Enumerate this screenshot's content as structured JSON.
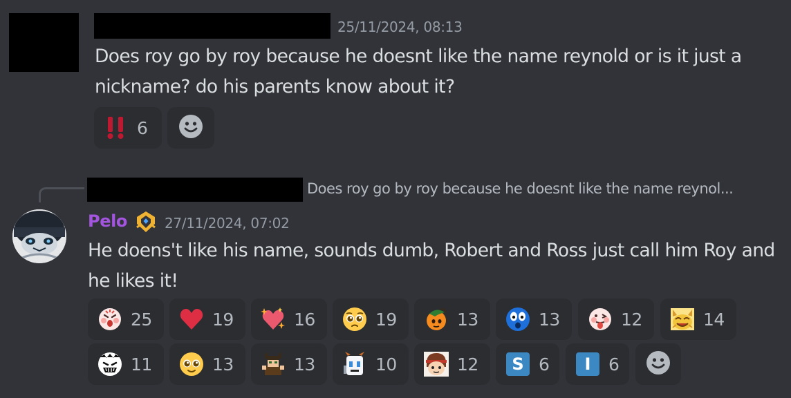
{
  "message1": {
    "timestamp": "25/11/2024, 08:13",
    "text": "Does roy go by roy because he doesnt like the name reynold or is it just a nickname? do his parents know about it?",
    "reactions": [
      {
        "emoji": "double-exclamation",
        "count": "6"
      }
    ]
  },
  "message2": {
    "reply_preview": "Does roy go by roy because he doesnt like the name reynol...",
    "author": "Pelo",
    "author_color": "#a455df",
    "timestamp": "27/11/2024, 07:02",
    "text": "He doens't like his name, sounds dumb, Robert and Ross just call him Roy and he likes it!",
    "reactions": [
      {
        "emoji": "shocked-face",
        "count": "25"
      },
      {
        "emoji": "red-heart",
        "count": "19"
      },
      {
        "emoji": "sparkling-heart",
        "count": "16"
      },
      {
        "emoji": "pleading-face",
        "count": "19"
      },
      {
        "emoji": "orange-character",
        "count": "13"
      },
      {
        "emoji": "blue-shocked-face",
        "count": "13"
      },
      {
        "emoji": "tongue-face",
        "count": "12"
      },
      {
        "emoji": "yellow-cat-face",
        "count": "14"
      },
      {
        "emoji": "white-grin-face",
        "count": "11"
      },
      {
        "emoji": "pleading-face-2",
        "count": "13"
      },
      {
        "emoji": "pixel-character",
        "count": "13"
      },
      {
        "emoji": "white-character",
        "count": "10"
      },
      {
        "emoji": "brown-hair-character",
        "count": "12"
      },
      {
        "emoji": "letter-s",
        "letter": "S",
        "count": "6"
      },
      {
        "emoji": "letter-i",
        "letter": "I",
        "count": "6"
      }
    ]
  },
  "colors": {
    "background": "#313338",
    "reaction_bg": "#2b2d31",
    "timestamp": "#949ba4",
    "text": "#dbdee1"
  }
}
